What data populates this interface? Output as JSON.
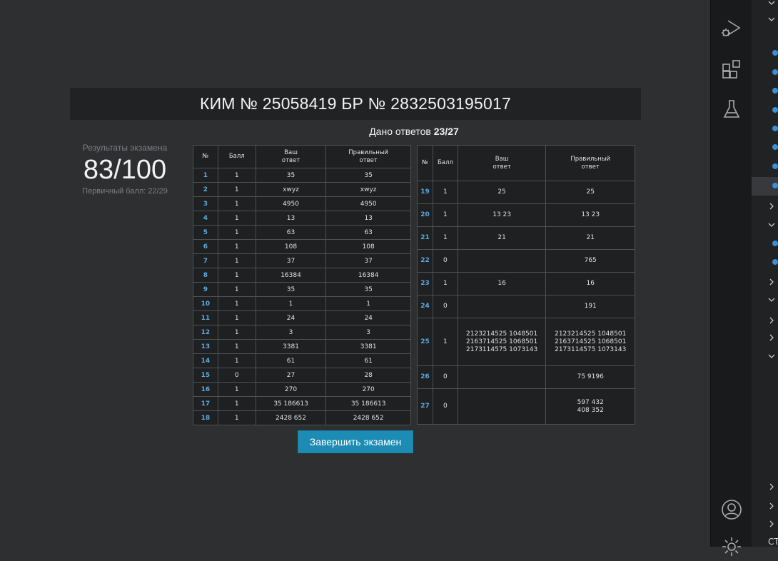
{
  "header": {
    "title": "КИМ № 25058419 БР № 2832503195017",
    "answers_label": "Дано ответов",
    "answers_value": "23/27"
  },
  "score": {
    "label": "Результаты экзамена",
    "value": "83/100",
    "primary": "Первичный балл: 22/29"
  },
  "columns": {
    "num": "№",
    "score": "Балл",
    "your": "Ваш\nответ",
    "correct": "Правильный\nответ"
  },
  "left_rows": [
    {
      "n": "1",
      "s": "1",
      "a": "35",
      "c": "35"
    },
    {
      "n": "2",
      "s": "1",
      "a": "xwyz",
      "c": "xwyz"
    },
    {
      "n": "3",
      "s": "1",
      "a": "4950",
      "c": "4950"
    },
    {
      "n": "4",
      "s": "1",
      "a": "13",
      "c": "13"
    },
    {
      "n": "5",
      "s": "1",
      "a": "63",
      "c": "63"
    },
    {
      "n": "6",
      "s": "1",
      "a": "108",
      "c": "108"
    },
    {
      "n": "7",
      "s": "1",
      "a": "37",
      "c": "37"
    },
    {
      "n": "8",
      "s": "1",
      "a": "16384",
      "c": "16384"
    },
    {
      "n": "9",
      "s": "1",
      "a": "35",
      "c": "35"
    },
    {
      "n": "10",
      "s": "1",
      "a": "1",
      "c": "1"
    },
    {
      "n": "11",
      "s": "1",
      "a": "24",
      "c": "24"
    },
    {
      "n": "12",
      "s": "1",
      "a": "3",
      "c": "3"
    },
    {
      "n": "13",
      "s": "1",
      "a": "3381",
      "c": "3381"
    },
    {
      "n": "14",
      "s": "1",
      "a": "61",
      "c": "61"
    },
    {
      "n": "15",
      "s": "0",
      "a": "27",
      "c": "28"
    },
    {
      "n": "16",
      "s": "1",
      "a": "270",
      "c": "270"
    },
    {
      "n": "17",
      "s": "1",
      "a": "35 186613",
      "c": "35 186613"
    },
    {
      "n": "18",
      "s": "1",
      "a": "2428 652",
      "c": "2428 652"
    }
  ],
  "right_rows": [
    {
      "n": "19",
      "s": "1",
      "a": "25",
      "c": "25"
    },
    {
      "n": "20",
      "s": "1",
      "a": "13 23",
      "c": "13 23"
    },
    {
      "n": "21",
      "s": "1",
      "a": "21",
      "c": "21"
    },
    {
      "n": "22",
      "s": "0",
      "a": "",
      "c": "765"
    },
    {
      "n": "23",
      "s": "1",
      "a": "16",
      "c": "16"
    },
    {
      "n": "24",
      "s": "0",
      "a": "",
      "c": "191"
    },
    {
      "n": "25",
      "s": "1",
      "a": "2123214525 1048501\n2163714525 1068501\n2173114575 1073143",
      "c": "2123214525 1048501\n2163714525 1068501\n2173114575 1073143"
    },
    {
      "n": "26",
      "s": "0",
      "a": "",
      "c": "75 9196"
    },
    {
      "n": "27",
      "s": "0",
      "a": "",
      "c": "597 432\n408 352"
    }
  ],
  "finish_button": "Завершить экзамен",
  "sidebar": {
    "icons": [
      "run-debug-icon",
      "extensions-icon",
      "testing-icon",
      "account-icon",
      "settings-gear-icon"
    ],
    "bottom_text": "СТ"
  }
}
